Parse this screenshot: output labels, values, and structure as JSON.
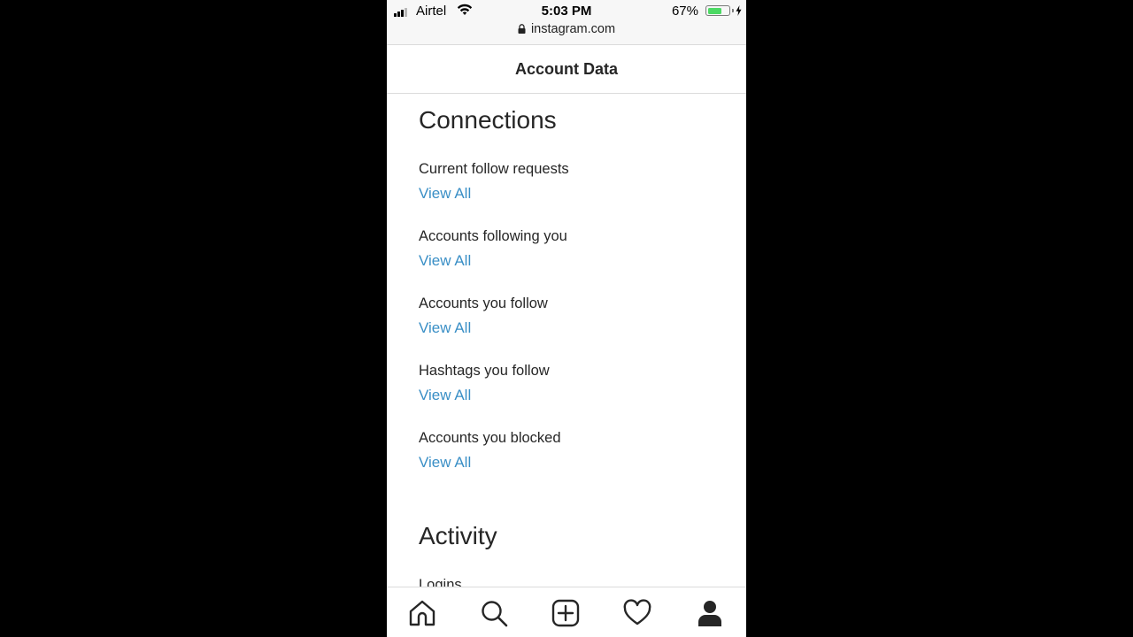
{
  "status_bar": {
    "carrier": "Airtel",
    "time": "5:03 PM",
    "battery_percent": "67%",
    "battery_level": 0.67
  },
  "url_bar": {
    "url": "instagram.com"
  },
  "header": {
    "title": "Account Data"
  },
  "sections": [
    {
      "title": "Connections",
      "items": [
        {
          "label": "Current follow requests",
          "action": "View All"
        },
        {
          "label": "Accounts following you",
          "action": "View All"
        },
        {
          "label": "Accounts you follow",
          "action": "View All"
        },
        {
          "label": "Hashtags you follow",
          "action": "View All"
        },
        {
          "label": "Accounts you blocked",
          "action": "View All"
        }
      ]
    },
    {
      "title": "Activity",
      "items": [
        {
          "label": "Logins"
        }
      ]
    }
  ],
  "bottom_nav": {
    "items": [
      "home-icon",
      "search-icon",
      "new-post-icon",
      "activity-heart-icon",
      "profile-icon"
    ]
  },
  "colors": {
    "link": "#3a8fc6",
    "battery": "#4cd964",
    "divider": "#dbdbdb"
  }
}
